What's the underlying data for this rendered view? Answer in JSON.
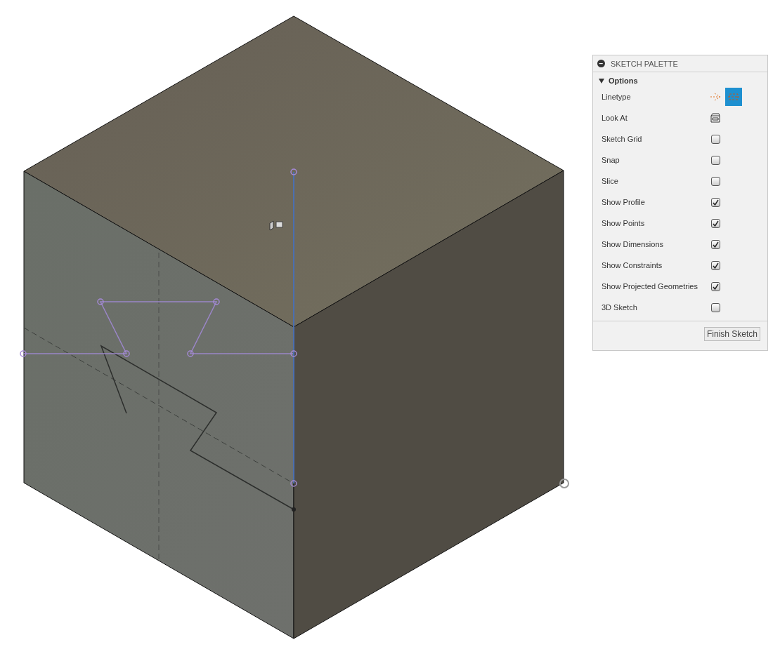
{
  "palette": {
    "title": "SKETCH PALETTE",
    "collapse_glyph": "−",
    "section": {
      "title": "Options",
      "expanded": true
    },
    "options": [
      {
        "kind": "linetype",
        "label": "Linetype",
        "choices": [
          {
            "kind": "construction",
            "selected": false
          },
          {
            "kind": "centerline",
            "selected": true
          }
        ]
      },
      {
        "kind": "button",
        "label": "Look At"
      },
      {
        "kind": "checkbox",
        "label": "Sketch Grid",
        "checked": false
      },
      {
        "kind": "checkbox",
        "label": "Snap",
        "checked": false
      },
      {
        "kind": "checkbox",
        "label": "Slice",
        "checked": false
      },
      {
        "kind": "checkbox",
        "label": "Show Profile",
        "checked": true
      },
      {
        "kind": "checkbox",
        "label": "Show Points",
        "checked": true
      },
      {
        "kind": "checkbox",
        "label": "Show Dimensions",
        "checked": true
      },
      {
        "kind": "checkbox",
        "label": "Show Constraints",
        "checked": true
      },
      {
        "kind": "checkbox",
        "label": "Show Projected Geometries",
        "checked": true
      },
      {
        "kind": "checkbox",
        "label": "3D Sketch",
        "checked": false
      }
    ],
    "finish_button": "Finish Sketch"
  }
}
